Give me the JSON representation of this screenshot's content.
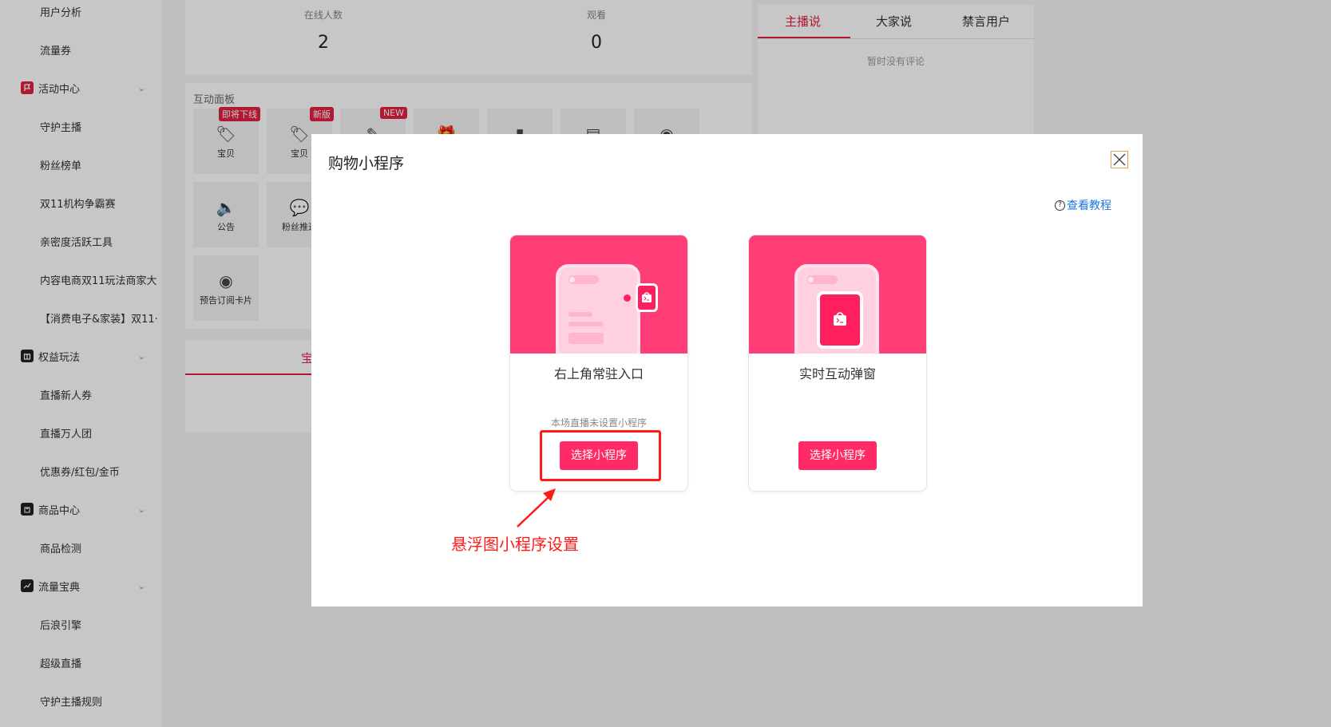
{
  "sidebar": {
    "items": [
      {
        "label": "用户分析",
        "type": "sub"
      },
      {
        "label": "流量券",
        "type": "sub"
      },
      {
        "label": "活动中心",
        "type": "group",
        "icon": "flag-icon",
        "color": "#e0203f"
      },
      {
        "label": "守护主播",
        "type": "sub"
      },
      {
        "label": "粉丝榜单",
        "type": "sub"
      },
      {
        "label": "双11机构争霸赛",
        "type": "sub"
      },
      {
        "label": "亲密度活跃工具",
        "type": "sub"
      },
      {
        "label": "内容电商双11玩法商家大",
        "type": "sub"
      },
      {
        "label": "【消费电子&家装】双11·",
        "type": "sub"
      },
      {
        "label": "权益玩法",
        "type": "group",
        "icon": "gift-box-icon",
        "color": "#222"
      },
      {
        "label": "直播新人券",
        "type": "sub"
      },
      {
        "label": "直播万人团",
        "type": "sub"
      },
      {
        "label": "优惠券/红包/金币",
        "type": "sub"
      },
      {
        "label": "商品中心",
        "type": "group",
        "icon": "shopping-bag-icon",
        "color": "#222"
      },
      {
        "label": "商品检测",
        "type": "sub"
      },
      {
        "label": "流量宝典",
        "type": "group",
        "icon": "trend-chart-icon",
        "color": "#222"
      },
      {
        "label": "后浪引擎",
        "type": "sub"
      },
      {
        "label": "超级直播",
        "type": "sub"
      },
      {
        "label": "守护主播规则",
        "type": "sub"
      }
    ]
  },
  "stats": {
    "online": {
      "label": "在线人数",
      "value": "2"
    },
    "watch": {
      "label": "观看",
      "value": "0"
    }
  },
  "panel": {
    "title": "互动面板",
    "tiles": [
      {
        "label": "宝贝",
        "badge": "即将下线",
        "icon": "tag-icon"
      },
      {
        "label": "宝贝",
        "badge": "新版",
        "icon": "tag-icon"
      },
      {
        "label": "",
        "badge": "NEW",
        "icon": "pen-icon"
      },
      {
        "label": "",
        "badge": "",
        "icon": "gift-icon"
      },
      {
        "label": "",
        "badge": "",
        "icon": "bar-chart-icon"
      },
      {
        "label": "",
        "badge": "",
        "icon": "coupon-icon"
      },
      {
        "label": "",
        "badge": "",
        "icon": "broadcast-icon"
      },
      {
        "label": "公告",
        "badge": "",
        "icon": "speaker-icon"
      },
      {
        "label": "粉丝推送",
        "badge": "",
        "icon": "chat-icon"
      },
      {
        "label": "预告订阅卡片",
        "badge": "",
        "icon": "broadcast-icon"
      }
    ]
  },
  "lower": {
    "tab": "宝"
  },
  "comments": {
    "tabs": [
      "主播说",
      "大家说",
      "禁言用户"
    ],
    "empty": "暂时没有评论"
  },
  "modal": {
    "title": "购物小程序",
    "tutorial": "查看教程",
    "cards": [
      {
        "title": "右上角常驻入口",
        "note": "本场直播未设置小程序",
        "button": "选择小程序"
      },
      {
        "title": "实时互动弹窗",
        "note": "",
        "button": "选择小程序"
      }
    ],
    "annotation": "悬浮图小程序设置"
  },
  "colors": {
    "accent": "#ff2a66",
    "brand_red": "#e0203f",
    "annotation_red": "#ff1a1a",
    "link": "#1a73e8"
  }
}
